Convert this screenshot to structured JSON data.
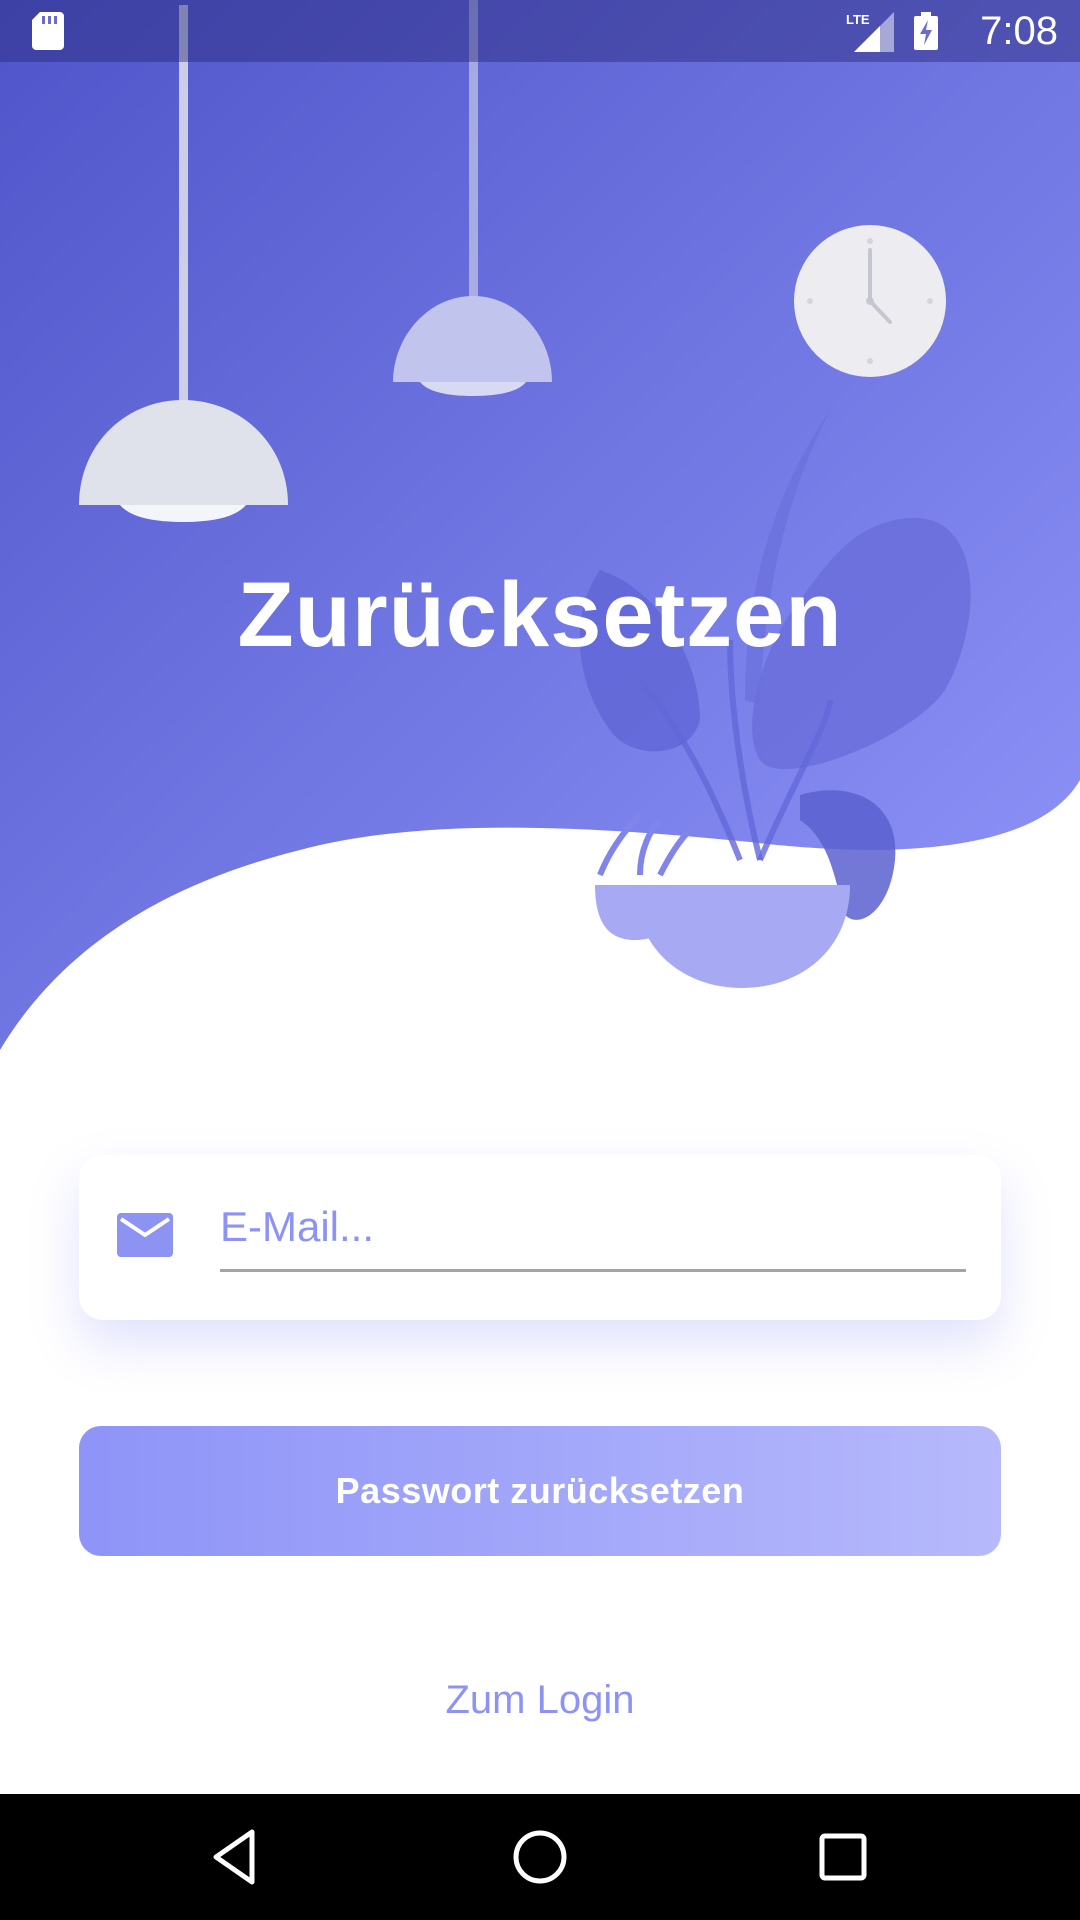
{
  "status_bar": {
    "time": "7:08",
    "network": "LTE",
    "icons": [
      "sd-card-icon",
      "lte-signal-icon",
      "battery-charging-icon"
    ]
  },
  "hero": {
    "title": "Zurücksetzen",
    "illustration": [
      "lamp-icon",
      "lamp-icon",
      "clock-icon",
      "plant-icon"
    ]
  },
  "form": {
    "email_placeholder": "E-Mail...",
    "email_value": "",
    "email_icon": "mail-icon",
    "submit_label": "Passwort zurücksetzen",
    "login_link": "Zum Login"
  },
  "nav_bar": {
    "buttons": [
      "back-icon",
      "home-icon",
      "recents-icon"
    ]
  },
  "colors": {
    "gradient_start": "#4f55c9",
    "gradient_end": "#9096fa",
    "accent": "#8d93f2",
    "button_gradient_start": "#8e94f8",
    "button_gradient_end": "#b6b9fb",
    "lamp": "#dfe2ea"
  }
}
